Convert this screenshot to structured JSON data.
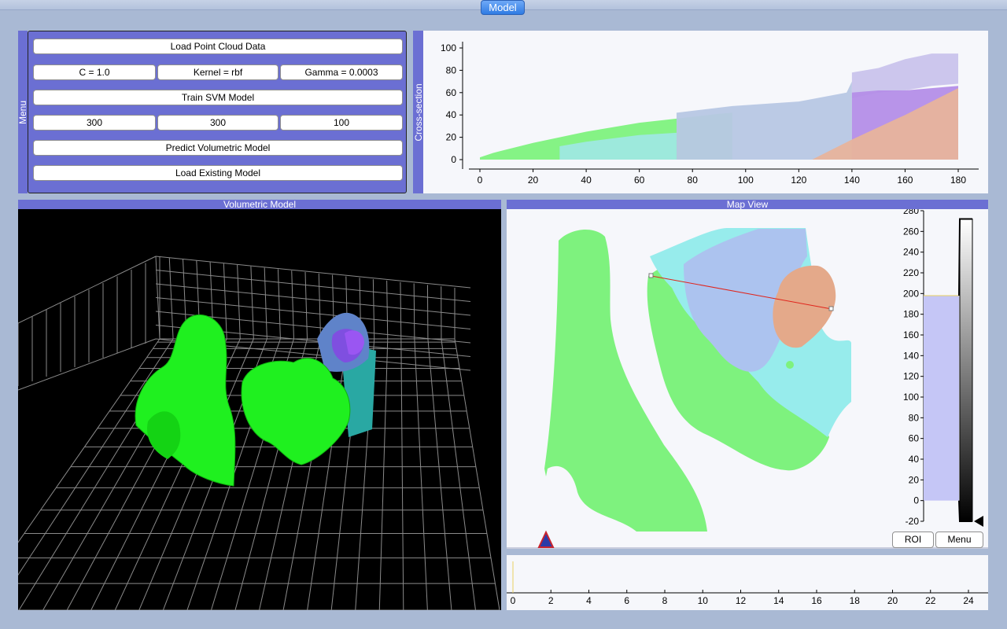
{
  "app": {
    "tab_label": "Model"
  },
  "menu": {
    "title": "Menu",
    "load_label": "Load Point Cloud Data",
    "c_label": "C = 1.0",
    "kernel_label": "Kernel = rbf",
    "gamma_label": "Gamma = 0.0003",
    "train_label": "Train SVM Model",
    "grid_x": "300",
    "grid_y": "300",
    "grid_z": "100",
    "predict_label": "Predict Volumetric Model",
    "load_existing_label": "Load Existing Model"
  },
  "cross_section": {
    "title": "Cross-section",
    "chart_data": {
      "type": "area",
      "x_ticks": [
        "0",
        "20",
        "40",
        "60",
        "80",
        "100",
        "120",
        "140",
        "160",
        "180"
      ],
      "y_ticks": [
        "0",
        "20",
        "40",
        "60",
        "80",
        "100"
      ],
      "xlim": [
        0,
        180
      ],
      "ylim": [
        0,
        100
      ],
      "layers": [
        {
          "color": "#7ef27e",
          "x": [
            0,
            5,
            20,
            40,
            60,
            75,
            90,
            95
          ],
          "top": [
            2,
            6,
            15,
            25,
            33,
            37,
            41,
            42
          ],
          "bottom": [
            0,
            0,
            0,
            0,
            0,
            0,
            0,
            0
          ]
        },
        {
          "color": "#9ee8e0",
          "x": [
            30,
            40,
            60,
            74
          ],
          "top": [
            12,
            16,
            22,
            24
          ],
          "bottom": [
            0,
            0,
            0,
            0
          ]
        },
        {
          "color": "#b7c7e4",
          "x": [
            74,
            95,
            120,
            138,
            140
          ],
          "top": [
            42,
            48,
            52,
            60,
            70
          ],
          "bottom": [
            0,
            0,
            0,
            0,
            0
          ]
        },
        {
          "color": "#c9c3ec",
          "x": [
            140,
            150,
            160,
            170,
            180
          ],
          "top": [
            78,
            82,
            90,
            95,
            95
          ],
          "bottom": [
            55,
            60,
            62,
            66,
            68
          ]
        },
        {
          "color": "#b48ee8",
          "x": [
            140,
            150,
            160,
            170,
            180
          ],
          "top": [
            60,
            62,
            62,
            64,
            66
          ],
          "bottom": [
            0,
            0,
            0,
            0,
            0
          ]
        },
        {
          "color": "#e7b39c",
          "x": [
            125,
            140,
            160,
            180
          ],
          "top": [
            0,
            18,
            40,
            64
          ],
          "bottom": [
            0,
            0,
            0,
            0
          ]
        }
      ]
    }
  },
  "volumetric": {
    "title": "Volumetric Model"
  },
  "map_view": {
    "title": "Map View",
    "colorbar_ticks": [
      "280",
      "260",
      "240",
      "220",
      "200",
      "180",
      "160",
      "140",
      "120",
      "100",
      "80",
      "60",
      "40",
      "20",
      "0",
      "-20"
    ],
    "roi_label": "ROI",
    "menu_label": "Menu",
    "section_line_color": "#e0241b"
  },
  "timeline": {
    "ticks": [
      "0",
      "2",
      "4",
      "6",
      "8",
      "10",
      "12",
      "14",
      "16",
      "18",
      "20",
      "22",
      "24"
    ]
  }
}
